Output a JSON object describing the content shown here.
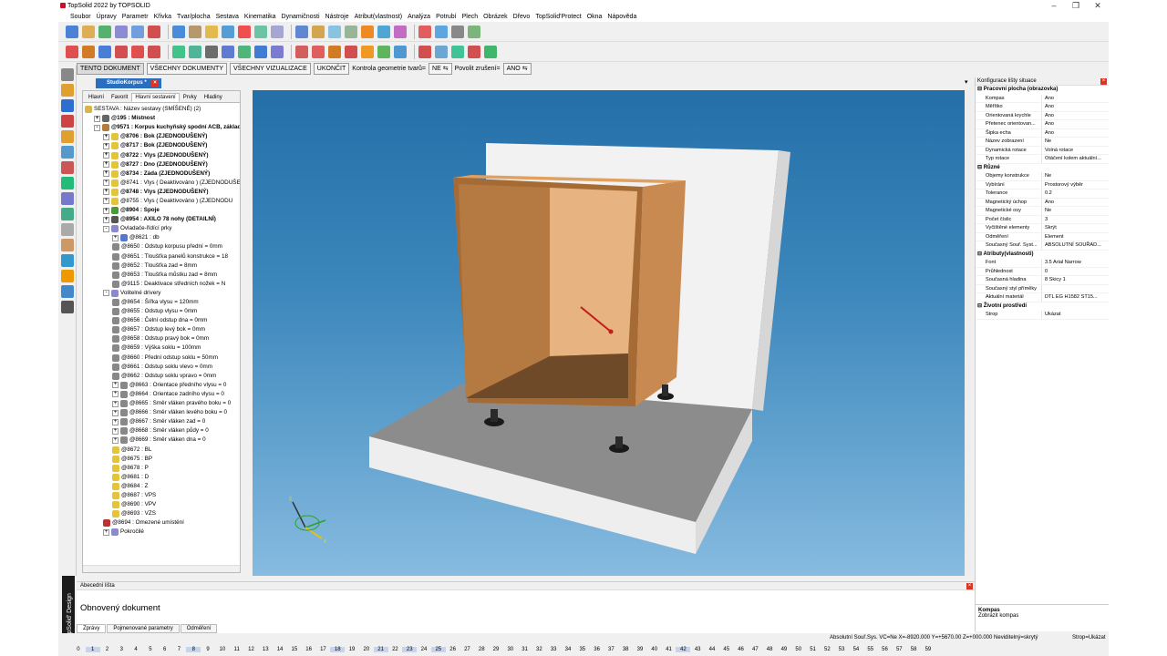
{
  "app": {
    "title": "TopSolid 2022 by TOPSOLID"
  },
  "menu": [
    "Soubor",
    "Úpravy",
    "Parametr",
    "Křivka",
    "Tvar/plocha",
    "Sestava",
    "Kinematika",
    "Dynamičnosti",
    "Nástroje",
    "Atribut(vlastnost)",
    "Analýza",
    "Potrubí",
    "Plech",
    "Obrázek",
    "Dřevo",
    "TopSolid'Protect",
    "Okna",
    "Nápověda"
  ],
  "context": {
    "buttons": [
      "TENTO DOKUMENT",
      "VŠECHNY DOKUMENTY",
      "VŠECHNY VIZUALIZACE",
      "UKONČIT"
    ],
    "check_label": "Kontrola geometrie tvarů=",
    "check_value": "NE",
    "undo_label": "Povolit zrušení=",
    "undo_value": "ANO"
  },
  "doc_tab": "StudioKorpus *",
  "brand": "TopSolid' Design",
  "left_panel": {
    "tabs": [
      "Hlavní",
      "Favorit",
      "Hlavní sestavení",
      "Prvky",
      "Hladiny"
    ],
    "selected_tab": "Hlavní sestavení"
  },
  "tree": [
    {
      "t": "SESTAVA : Název sestavy (SMÍŠENÉ) (2)",
      "l": 0,
      "b": false,
      "x": "",
      "c": "#d7b54a"
    },
    {
      "t": "@195 : Místnost",
      "l": 1,
      "b": true,
      "x": "+",
      "c": "#666"
    },
    {
      "t": "@9571 : Korpus kuchyňský spodní ACB, základ",
      "l": 1,
      "b": true,
      "x": "-",
      "c": "#b07d3a"
    },
    {
      "t": "@8706 : Bok  (ZJEDNODUŠENÝ)",
      "l": 2,
      "b": true,
      "x": "+",
      "c": "#e6c43a"
    },
    {
      "t": "@8717 : Bok  (ZJEDNODUŠENÝ)",
      "l": 2,
      "b": true,
      "x": "+",
      "c": "#e6c43a"
    },
    {
      "t": "@8722 : Vlys  (ZJEDNODUŠENÝ)",
      "l": 2,
      "b": true,
      "x": "+",
      "c": "#e6c43a"
    },
    {
      "t": "@8727 : Dno  (ZJEDNODUŠENÝ)",
      "l": 2,
      "b": true,
      "x": "+",
      "c": "#e6c43a"
    },
    {
      "t": "@8734 : Záda  (ZJEDNODUŠENÝ)",
      "l": 2,
      "b": true,
      "x": "+",
      "c": "#e6c43a"
    },
    {
      "t": "@8741 : Vlys  ( Deaktivováno ) (ZJEDNODUŠE",
      "l": 2,
      "b": false,
      "x": "+",
      "c": "#e6c43a"
    },
    {
      "t": "@8748 : Vlys  (ZJEDNODUŠENÝ)",
      "l": 2,
      "b": true,
      "x": "+",
      "c": "#e6c43a"
    },
    {
      "t": "@8755 : Vlys  ( Deaktivováno ) (ZJEDNODU",
      "l": 2,
      "b": false,
      "x": "+",
      "c": "#e6c43a"
    },
    {
      "t": "@8904 : Spoje",
      "l": 2,
      "b": true,
      "x": "+",
      "c": "#4a9a3a"
    },
    {
      "t": "@8954 : AXILO 78 nohy  (DETAILNÍ)",
      "l": 2,
      "b": true,
      "x": "+",
      "c": "#555"
    },
    {
      "t": "Ovladače-řídící prky",
      "l": 2,
      "b": false,
      "x": "-",
      "c": "#8a8ad0"
    },
    {
      "t": "@8621 : db",
      "l": 3,
      "b": false,
      "x": "+",
      "c": "#5577cc"
    },
    {
      "t": "@8650 : Odstup korpusu přední = 0mm",
      "l": 3,
      "b": false,
      "x": "",
      "c": "#888"
    },
    {
      "t": "@8651 : Tloušťka panelů konstrukce = 18",
      "l": 3,
      "b": false,
      "x": "",
      "c": "#888"
    },
    {
      "t": "@8652 : Tloušťka zad = 8mm",
      "l": 3,
      "b": false,
      "x": "",
      "c": "#888"
    },
    {
      "t": "@8653 : Tloušťka můstku zad = 8mm",
      "l": 3,
      "b": false,
      "x": "",
      "c": "#888"
    },
    {
      "t": "@9115 : Deaktivace středních nožek = N",
      "l": 3,
      "b": false,
      "x": "",
      "c": "#888"
    },
    {
      "t": "Volitelné drivery",
      "l": 2,
      "b": false,
      "x": "-",
      "c": "#8a8ad0"
    },
    {
      "t": "@8654 : Šířka vlysu = 120mm",
      "l": 3,
      "b": false,
      "x": "",
      "c": "#888"
    },
    {
      "t": "@8655 : Odstup vlysu = 0mm",
      "l": 3,
      "b": false,
      "x": "",
      "c": "#888"
    },
    {
      "t": "@8656 : Čelní odstup dna = 0mm",
      "l": 3,
      "b": false,
      "x": "",
      "c": "#888"
    },
    {
      "t": "@8657 : Odstup levý bok = 0mm",
      "l": 3,
      "b": false,
      "x": "",
      "c": "#888"
    },
    {
      "t": "@8658 : Odstup pravý bok = 0mm",
      "l": 3,
      "b": false,
      "x": "",
      "c": "#888"
    },
    {
      "t": "@8659 : Výška soklu = 100mm",
      "l": 3,
      "b": false,
      "x": "",
      "c": "#888"
    },
    {
      "t": "@8660 : Přední odstup soklu = 50mm",
      "l": 3,
      "b": false,
      "x": "",
      "c": "#888"
    },
    {
      "t": "@8661 : Odstup soklu vlevo = 0mm",
      "l": 3,
      "b": false,
      "x": "",
      "c": "#888"
    },
    {
      "t": "@8662 : Odstup soklu vpravo = 0mm",
      "l": 3,
      "b": false,
      "x": "",
      "c": "#888"
    },
    {
      "t": "@8663 : Orientace předního vlysu = 0",
      "l": 3,
      "b": false,
      "x": "+",
      "c": "#888"
    },
    {
      "t": "@8664 : Orientace zadního vlysu = 0",
      "l": 3,
      "b": false,
      "x": "+",
      "c": "#888"
    },
    {
      "t": "@8665 : Směr vláken pravého boku = 0",
      "l": 3,
      "b": false,
      "x": "+",
      "c": "#888"
    },
    {
      "t": "@8666 : Směr vláken levého boku = 0",
      "l": 3,
      "b": false,
      "x": "+",
      "c": "#888"
    },
    {
      "t": "@8667 : Směr vláken zad = 0",
      "l": 3,
      "b": false,
      "x": "+",
      "c": "#888"
    },
    {
      "t": "@8668 : Směr vláken půdy = 0",
      "l": 3,
      "b": false,
      "x": "+",
      "c": "#888"
    },
    {
      "t": "@8669 : Směr vláken dna = 0",
      "l": 3,
      "b": false,
      "x": "+",
      "c": "#888"
    },
    {
      "t": "@8672 : BL",
      "l": 3,
      "b": false,
      "x": "",
      "c": "#e6c43a"
    },
    {
      "t": "@8675 : BP",
      "l": 3,
      "b": false,
      "x": "",
      "c": "#e6c43a"
    },
    {
      "t": "@8678 : P",
      "l": 3,
      "b": false,
      "x": "",
      "c": "#e6c43a"
    },
    {
      "t": "@8681 : D",
      "l": 3,
      "b": false,
      "x": "",
      "c": "#e6c43a"
    },
    {
      "t": "@8684 : Z",
      "l": 3,
      "b": false,
      "x": "",
      "c": "#e6c43a"
    },
    {
      "t": "@8687 : VPS",
      "l": 3,
      "b": false,
      "x": "",
      "c": "#e6c43a"
    },
    {
      "t": "@8690 : VPV",
      "l": 3,
      "b": false,
      "x": "",
      "c": "#e6c43a"
    },
    {
      "t": "@8693 : VZS",
      "l": 3,
      "b": false,
      "x": "",
      "c": "#e6c43a"
    },
    {
      "t": "@8694 : Omezené umístění",
      "l": 2,
      "b": false,
      "x": "",
      "c": "#c03030"
    },
    {
      "t": "Pokročilé",
      "l": 2,
      "b": false,
      "x": "+",
      "c": "#8a8ad0"
    }
  ],
  "properties": {
    "title": "Konfigurace lišty situace",
    "sections": [
      {
        "name": "Pracovní plocha (obrazovka)",
        "rows": [
          [
            "Kompas",
            "Ano"
          ],
          [
            "Měřítko",
            "Ano"
          ],
          [
            "Orientovaná krychle",
            "Ano"
          ],
          [
            "Přetenec orientovan...",
            "Ano"
          ],
          [
            "Šipka echa",
            "Ano"
          ],
          [
            "Název zobrazení",
            "Ne"
          ],
          [
            "Dynamická rotace",
            "Volná rotace"
          ],
          [
            "Typ rotace",
            "Otáčení kolem aktuální..."
          ]
        ]
      },
      {
        "name": "Různé",
        "rows": [
          [
            "Objemy konstrukce",
            "Ne"
          ],
          [
            "Vybírání",
            "Prostorový výběr"
          ],
          [
            "Tolerance",
            "0.2"
          ],
          [
            "Magnetický úchop",
            "Ano"
          ],
          [
            "Magnetické osy",
            "Ne"
          ],
          [
            "Počet číslic",
            "3"
          ],
          [
            "Vyčištěné elementy",
            "Skrýt"
          ],
          [
            "Odměření",
            "Element"
          ],
          [
            "Současný Souř. Syst...",
            "ABSOLUTNÍ SOUŘAD..."
          ]
        ]
      },
      {
        "name": "Atributy(vlastnosti)",
        "rows": [
          [
            "Font",
            "3.5  Arial Narrow"
          ],
          [
            "Průhlednost",
            "0"
          ],
          [
            "Současná hladina",
            "8 Skicy 1"
          ],
          [
            "Současný styl příměky",
            ""
          ],
          [
            "Aktuální materiál",
            "DTL EG H1582 ST15..."
          ]
        ]
      },
      {
        "name": "Životní prostředí",
        "rows": [
          [
            "Strop",
            "Ukázat"
          ]
        ]
      }
    ],
    "footer_title": "Kompas",
    "footer_text": "Zobrazit kompas"
  },
  "bottom_panel": {
    "title": "Abecední lišta",
    "message": "Obnovený dokument",
    "tabs": [
      "Zprávy",
      "Pojmenované parametry",
      "Odměření"
    ],
    "selected_tab": "Zprávy"
  },
  "status": {
    "coords": "Absolutní Souř.Sys.    VC=Ne  X=-8920.000  Y=+5670.00  Z=+000.000  Neviditelný=skrytý",
    "ceiling": "Strop=Ukázat"
  },
  "layers": {
    "numbers": [
      "0",
      "1",
      "2",
      "3",
      "4",
      "5",
      "6",
      "7",
      "8",
      "9",
      "10",
      "11",
      "12",
      "13",
      "14",
      "15",
      "16",
      "17",
      "18",
      "19",
      "20",
      "21",
      "22",
      "23",
      "24",
      "25",
      "26",
      "27",
      "28",
      "29",
      "30",
      "31",
      "32",
      "33",
      "34",
      "35",
      "36",
      "37",
      "38",
      "39",
      "40",
      "41",
      "42",
      "43",
      "44",
      "45",
      "46",
      "47",
      "48",
      "49",
      "50",
      "51",
      "52",
      "53",
      "54",
      "55",
      "56",
      "57",
      "58",
      "59"
    ],
    "highlighted": [
      "1",
      "8",
      "18",
      "21",
      "23",
      "25",
      "42"
    ]
  }
}
